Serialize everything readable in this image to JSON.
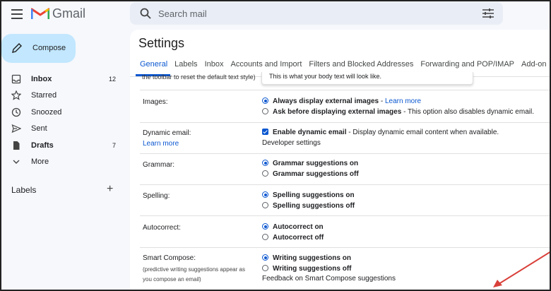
{
  "app": {
    "name": "Gmail"
  },
  "search": {
    "placeholder": "Search mail"
  },
  "sidebar": {
    "compose_label": "Compose",
    "items": [
      {
        "label": "Inbox",
        "count": "12",
        "bold": true
      },
      {
        "label": "Starred",
        "count": ""
      },
      {
        "label": "Snoozed",
        "count": ""
      },
      {
        "label": "Sent",
        "count": ""
      },
      {
        "label": "Drafts",
        "count": "7",
        "bold": true
      },
      {
        "label": "More",
        "count": ""
      }
    ],
    "labels_heading": "Labels"
  },
  "settings": {
    "title": "Settings",
    "tabs": [
      "General",
      "Labels",
      "Inbox",
      "Accounts and Import",
      "Filters and Blocked Addresses",
      "Forwarding and POP/IMAP",
      "Add-on"
    ],
    "active_tab": "General",
    "partial_label": "the toolbar to reset the default text style)",
    "preview_text": "This is what your body text will look like.",
    "images": {
      "label": "Images:",
      "opt1": "Always display external images",
      "opt1_sep": " - ",
      "opt1_link": "Learn more",
      "opt2": "Ask before displaying external images",
      "opt2_desc": " - This option also disables dynamic email."
    },
    "dynamic_email": {
      "label": "Dynamic email:",
      "learn_more": "Learn more",
      "opt": "Enable dynamic email",
      "opt_desc": " - Display dynamic email content when available.",
      "developer_link": "Developer settings"
    },
    "grammar": {
      "label": "Grammar:",
      "on": "Grammar suggestions on",
      "off": "Grammar suggestions off"
    },
    "spelling": {
      "label": "Spelling:",
      "on": "Spelling suggestions on",
      "off": "Spelling suggestions off"
    },
    "autocorrect": {
      "label": "Autocorrect:",
      "on": "Autocorrect on",
      "off": "Autocorrect off"
    },
    "smart_compose": {
      "label": "Smart Compose:",
      "sub1": "(predictive writing suggestions appear as",
      "sub2": "you compose an email)",
      "on": "Writing suggestions on",
      "off": "Writing suggestions off",
      "feedback_link": "Feedback on Smart Compose suggestions"
    }
  },
  "colors": {
    "accent": "#0b57d0",
    "compose_bg": "#c2e7ff",
    "annotation_arrow": "#d9403a"
  }
}
